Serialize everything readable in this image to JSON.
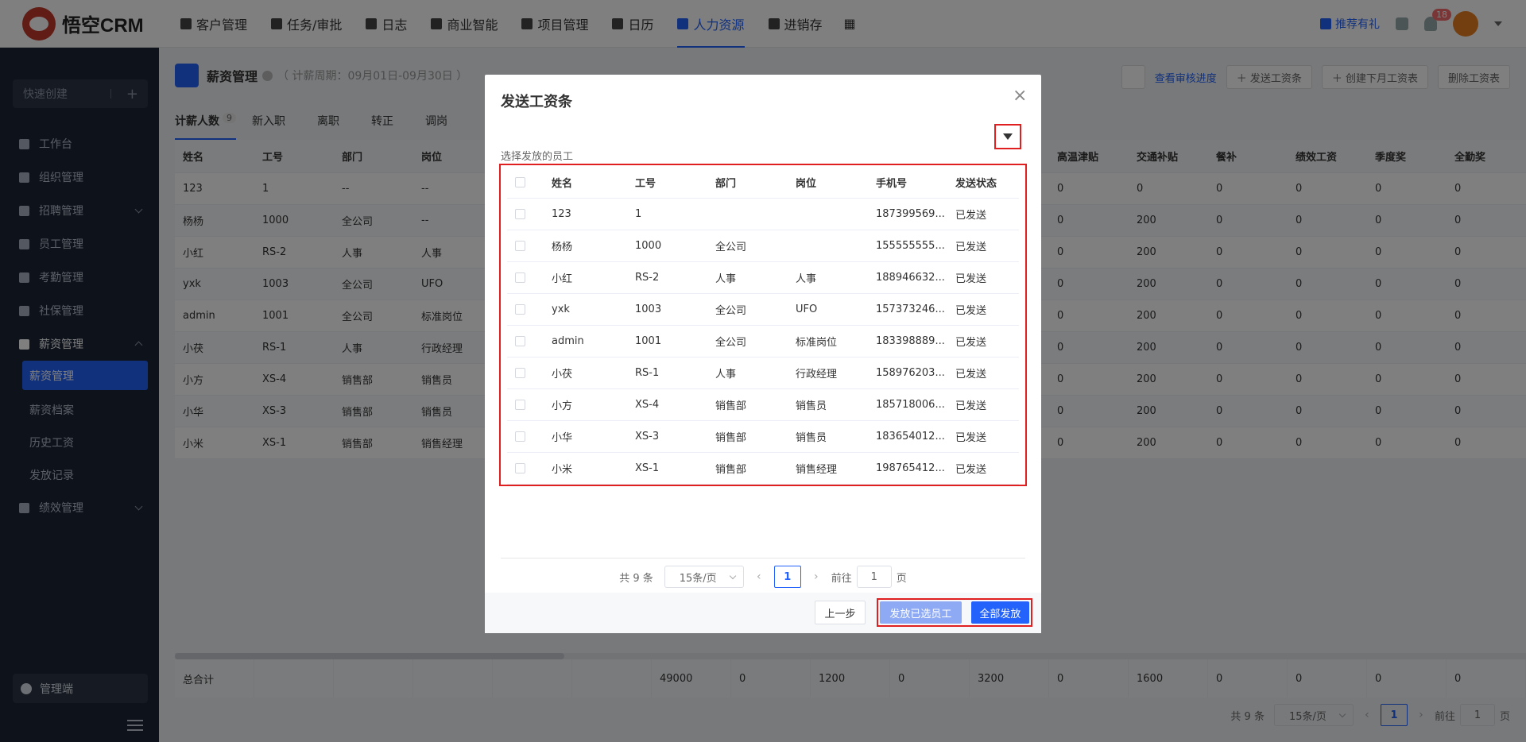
{
  "app": {
    "logo_text": "悟空CRM"
  },
  "topnav": {
    "items": [
      {
        "label": "客户管理",
        "icon": "customer-icon"
      },
      {
        "label": "任务/审批",
        "icon": "briefcase-icon"
      },
      {
        "label": "日志",
        "icon": "log-icon"
      },
      {
        "label": "商业智能",
        "icon": "bi-icon"
      },
      {
        "label": "项目管理",
        "icon": "project-icon"
      },
      {
        "label": "日历",
        "icon": "calendar-icon"
      },
      {
        "label": "人力资源",
        "icon": "hr-icon"
      },
      {
        "label": "进销存",
        "icon": "inventory-icon"
      }
    ],
    "active_index": 6,
    "gift_label": "推荐有礼",
    "notification_count": "18"
  },
  "sidebar": {
    "quick_create": "快速创建",
    "items": [
      {
        "label": "工作台"
      },
      {
        "label": "组织管理"
      },
      {
        "label": "招聘管理"
      },
      {
        "label": "员工管理"
      },
      {
        "label": "考勤管理"
      },
      {
        "label": "社保管理"
      },
      {
        "label": "薪资管理"
      },
      {
        "label": "绩效管理"
      }
    ],
    "sub_items": [
      {
        "label": "薪资管理"
      },
      {
        "label": "薪资档案"
      },
      {
        "label": "历史工资"
      },
      {
        "label": "发放记录"
      }
    ],
    "admin_label": "管理端"
  },
  "page": {
    "title": "薪资管理",
    "period": "（ 计薪周期：09月01日-09月30日 ）",
    "audit_link": "查看审核进度",
    "btn_send": "＋ 发送工资条",
    "btn_create": "＋ 创建下月工资表",
    "btn_delete": "删除工资表",
    "tabs": [
      {
        "label": "计薪人数",
        "count": "9"
      },
      {
        "label": "新入职"
      },
      {
        "label": "离职"
      },
      {
        "label": "转正"
      },
      {
        "label": "调岗"
      }
    ],
    "table": {
      "left_headers": [
        "姓名",
        "工号",
        "部门",
        "岗位"
      ],
      "right_headers": [
        "高温津贴",
        "交通补贴",
        "餐补",
        "绩效工资",
        "季度奖",
        "全勤奖"
      ],
      "rows": [
        {
          "left": [
            "123",
            "1",
            "--",
            "--"
          ],
          "right": [
            "0",
            "0",
            "0",
            "0",
            "0",
            "0"
          ]
        },
        {
          "left": [
            "杨杨",
            "1000",
            "全公司",
            "--"
          ],
          "right": [
            "0",
            "200",
            "0",
            "0",
            "0",
            "0"
          ]
        },
        {
          "left": [
            "小红",
            "RS-2",
            "人事",
            "人事"
          ],
          "right": [
            "0",
            "200",
            "0",
            "0",
            "0",
            "0"
          ]
        },
        {
          "left": [
            "yxk",
            "1003",
            "全公司",
            "UFO"
          ],
          "right": [
            "0",
            "200",
            "0",
            "0",
            "0",
            "0"
          ]
        },
        {
          "left": [
            "admin",
            "1001",
            "全公司",
            "标准岗位"
          ],
          "right": [
            "0",
            "200",
            "0",
            "0",
            "0",
            "0"
          ]
        },
        {
          "left": [
            "小茯",
            "RS-1",
            "人事",
            "行政经理"
          ],
          "right": [
            "0",
            "200",
            "0",
            "0",
            "0",
            "0"
          ]
        },
        {
          "left": [
            "小方",
            "XS-4",
            "销售部",
            "销售员"
          ],
          "right": [
            "0",
            "200",
            "0",
            "0",
            "0",
            "0"
          ]
        },
        {
          "left": [
            "小华",
            "XS-3",
            "销售部",
            "销售员"
          ],
          "right": [
            "0",
            "200",
            "0",
            "0",
            "0",
            "0"
          ]
        },
        {
          "left": [
            "小米",
            "XS-1",
            "销售部",
            "销售经理"
          ],
          "right": [
            "0",
            "200",
            "0",
            "0",
            "0",
            "0"
          ]
        }
      ],
      "totals": [
        "总合计",
        "",
        "",
        "",
        "",
        "",
        "49000",
        "0",
        "1200",
        "0",
        "3200",
        "0",
        "1600",
        "0",
        "0",
        "0",
        "0"
      ]
    },
    "pager": {
      "total": "共 9 条",
      "size": "15条/页",
      "current": "1",
      "goto_prefix": "前往",
      "goto_value": "1",
      "goto_suffix": "页"
    }
  },
  "dialog": {
    "title": "发送工资条",
    "subtitle": "选择发放的员工",
    "headers": [
      "姓名",
      "工号",
      "部门",
      "岗位",
      "手机号",
      "发送状态"
    ],
    "rows": [
      [
        "123",
        "1",
        "",
        "",
        "187399569...",
        "已发送"
      ],
      [
        "杨杨",
        "1000",
        "全公司",
        "",
        "155555555...",
        "已发送"
      ],
      [
        "小红",
        "RS-2",
        "人事",
        "人事",
        "188946632...",
        "已发送"
      ],
      [
        "yxk",
        "1003",
        "全公司",
        "UFO",
        "157373246...",
        "已发送"
      ],
      [
        "admin",
        "1001",
        "全公司",
        "标准岗位",
        "183398889...",
        "已发送"
      ],
      [
        "小茯",
        "RS-1",
        "人事",
        "行政经理",
        "158976203...",
        "已发送"
      ],
      [
        "小方",
        "XS-4",
        "销售部",
        "销售员",
        "185718006...",
        "已发送"
      ],
      [
        "小华",
        "XS-3",
        "销售部",
        "销售员",
        "183654012...",
        "已发送"
      ],
      [
        "小米",
        "XS-1",
        "销售部",
        "销售经理",
        "198765412...",
        "已发送"
      ]
    ],
    "pager": {
      "total": "共 9 条",
      "size": "15条/页",
      "current": "1",
      "goto_prefix": "前往",
      "goto_value": "1",
      "goto_suffix": "页"
    },
    "btn_prev": "上一步",
    "btn_send_selected": "发放已选员工",
    "btn_send_all": "全部发放"
  },
  "colors": {
    "accent": "#2362fb",
    "highlight": "#e02020",
    "sidebar_bg": "#1b2436"
  }
}
